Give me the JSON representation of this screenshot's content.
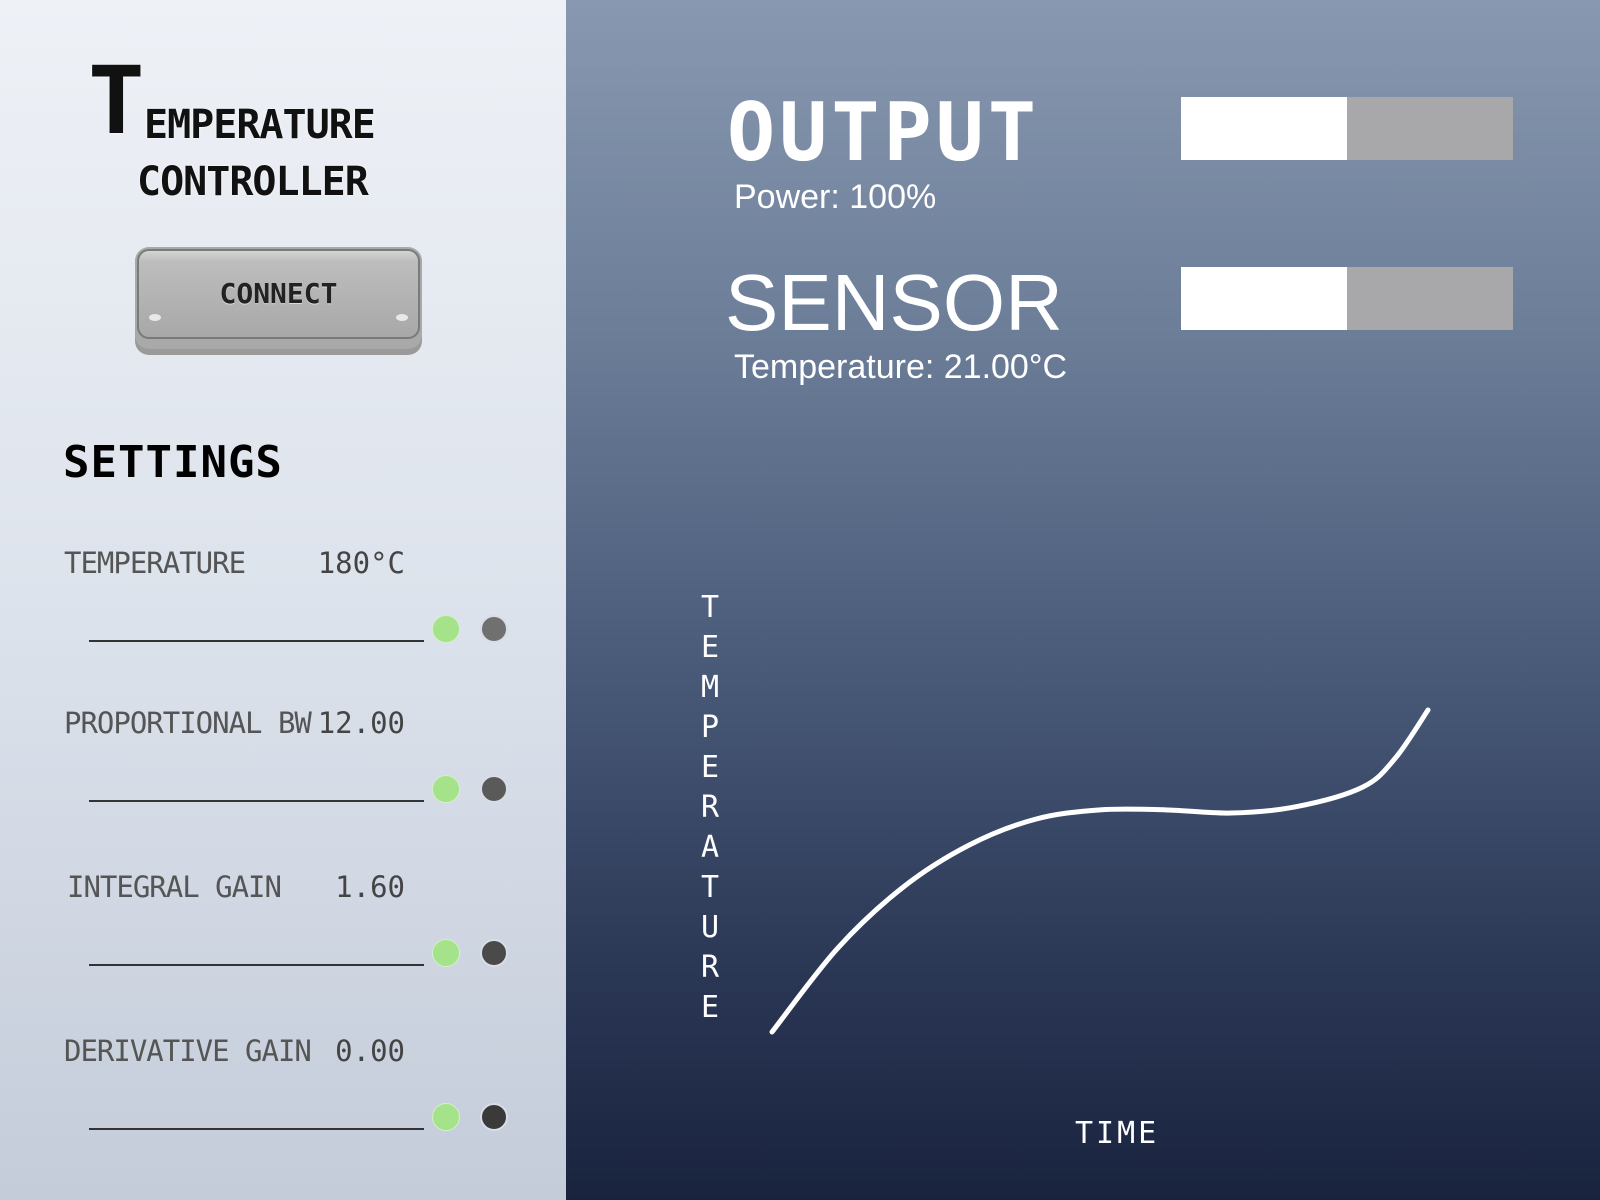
{
  "app": {
    "title_cap": "T",
    "title_line1": "EMPERATURE",
    "title_line2": "CONTROLLER"
  },
  "connect": {
    "label": "CONNECT"
  },
  "settings": {
    "heading": "SETTINGS",
    "items": [
      {
        "label": "TEMPERATURE",
        "value": "180°C",
        "dot_dark_color": "#707070"
      },
      {
        "label": "PROPORTIONAL BW",
        "value": "12.00",
        "dot_dark_color": "#5a5a5a"
      },
      {
        "label": "INTEGRAL GAIN",
        "value": "1.60",
        "dot_dark_color": "#4a4a4a"
      },
      {
        "label": "DERIVATIVE GAIN",
        "value": "0.00",
        "dot_dark_color": "#3a3a3a"
      }
    ]
  },
  "output": {
    "heading": "OUTPUT",
    "power_text": "Power: 100%",
    "bar_level": 0.5
  },
  "sensor": {
    "heading": "SENSOR",
    "temperature_text": "Temperature: 21.00°C",
    "bar_level": 0.5
  },
  "chart": {
    "ylabel": "TEMPERATURE",
    "xlabel": "TIME"
  },
  "chart_data": {
    "type": "line",
    "title": "",
    "xlabel": "TIME",
    "ylabel": "TEMPERATURE",
    "series": [
      {
        "x": [
          0,
          0.1,
          0.2,
          0.3,
          0.4,
          0.5,
          0.6,
          0.7,
          0.8,
          0.9,
          0.95,
          1.0
        ],
        "values": [
          0,
          0.26,
          0.45,
          0.58,
          0.66,
          0.69,
          0.69,
          0.68,
          0.7,
          0.76,
          0.85,
          1.0
        ]
      }
    ],
    "grid": false
  },
  "colors": {
    "accent_green": "#a4e38a",
    "bar_fill": "#ffffff",
    "bar_track": "#a8a7a9"
  }
}
